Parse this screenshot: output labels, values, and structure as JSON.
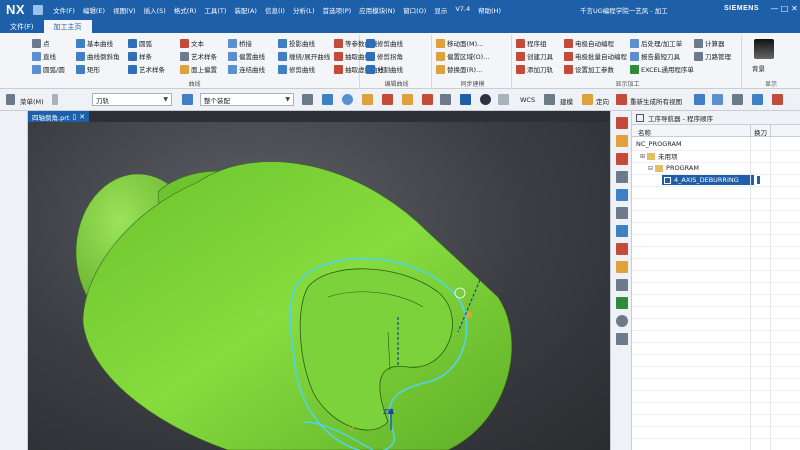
{
  "title_bar": {
    "logo": "NX",
    "menu": [
      "文件(F)",
      "编辑(E)",
      "视图(V)",
      "插入(S)",
      "格式(R)",
      "工具(T)",
      "装配(A)",
      "信息(I)",
      "分析(L)",
      "首选项(P)",
      "应用模块(N)",
      "窗口(O)",
      "显示",
      "帮助(H)"
    ],
    "version": "V7.4",
    "window_title": "千言UG编程学院一艺风 - 加工",
    "brand": "SIEMENS",
    "controls": [
      "—",
      "□",
      "✕"
    ]
  },
  "ribbon_tabs": [
    {
      "label": "文件(F)",
      "active": false
    },
    {
      "label": "加工主页",
      "active": true
    }
  ],
  "ribbon": {
    "groups": [
      {
        "title": "曲线",
        "items": [
          [
            "点",
            "基本曲线",
            "圆弧",
            "文本",
            "桥接",
            "投影曲线",
            "等参数曲线"
          ],
          [
            "直线",
            "曲线倒斜角",
            "样条",
            "艺术样条",
            "偏置曲线",
            "缠绕/展开曲线",
            "抽取曲线"
          ],
          [
            "圆弧/圆",
            "矩形",
            "艺术样条",
            "面上偏置",
            "连结曲线",
            "修剪曲线",
            "抽取虚拟曲线"
          ]
        ]
      },
      {
        "title": "编辑曲线",
        "items": [
          [
            "修剪曲线",
            "修剪拐角",
            "分割曲线"
          ]
        ]
      },
      {
        "title": "同步建模",
        "items": [
          [
            "移动面(M)...",
            "偏置区域(O)...",
            "替换面(R)..."
          ]
        ]
      },
      {
        "title": "",
        "items": [
          [
            "程序组",
            "创建刀具",
            "添加刀轨"
          ],
          [
            "电极自动编程",
            "电极批量自动编程",
            "设置加工参数"
          ],
          [
            "后处理/加工单",
            "报告最短刀具",
            "EXCEL通用程序单"
          ],
          [
            "计算器",
            "刀路管理"
          ]
        ]
      }
    ],
    "sub_labels": [
      "显示加工",
      "显示"
    ],
    "right_button": "背景"
  },
  "toolbar": {
    "menu_label": "菜单(M)",
    "filter_value": "刀轨",
    "scope_value": "整个装配",
    "wcs_label": "WCS",
    "button_labels": [
      "建模",
      "定向",
      "重新生成所有视图"
    ]
  },
  "document_tab": {
    "label": "四轴倒角.prt"
  },
  "viewport": {
    "model_color": "#7ed43a",
    "model_edge_color": "#3a6a1a",
    "highlight_color": "#4fd6e6",
    "axis_label": "ZM"
  },
  "navigator": {
    "title": "工序导航器 - 程序顺序",
    "columns": [
      "名称",
      "换刀"
    ],
    "tree": [
      {
        "label": "NC_PROGRAM",
        "level": 0
      },
      {
        "label": "未用项",
        "level": 1
      },
      {
        "label": "PROGRAM",
        "level": 1
      },
      {
        "label": "4_AXIS_DEBURRING",
        "level": 2,
        "selected": true
      }
    ]
  },
  "colors": {
    "titlebar": "#1d5fa8",
    "ribbon_bg": "#f3f5f8",
    "model_green": "#7ed43a",
    "selection_blue": "#1d5fa8"
  }
}
